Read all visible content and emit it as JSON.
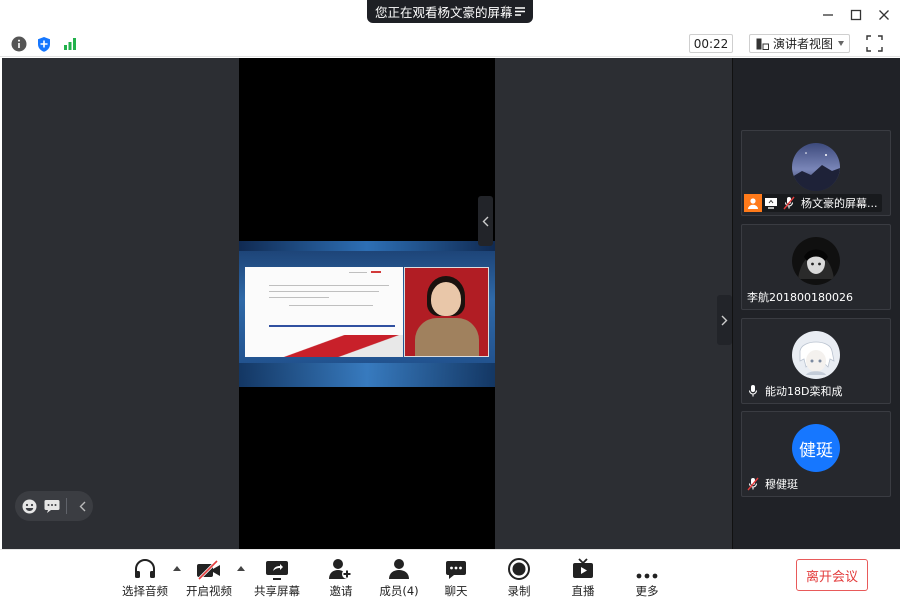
{
  "titlebar": {
    "title": "您正在观看杨文豪的屏幕",
    "menu_icon": "list-icon",
    "window_buttons": [
      "minimize-icon",
      "maximize-icon",
      "close-icon"
    ]
  },
  "infobar": {
    "icons": [
      "info-icon",
      "shield-icon",
      "signal-icon"
    ],
    "timer": "00:22",
    "view_mode": "演讲者视图",
    "fullscreen_icon": "fullscreen-icon"
  },
  "participants": [
    {
      "name": "杨文豪的屏幕...",
      "badges": [
        "host-icon",
        "screen-share-icon",
        "mic-muted-icon"
      ],
      "avatar": "night-sky-avatar"
    },
    {
      "name": "李航201800180026",
      "badges": [],
      "avatar": "dark-anime-avatar"
    },
    {
      "name": "能动18D栾和成",
      "badges": [
        "mic-icon"
      ],
      "avatar": "white-anime-avatar"
    },
    {
      "name": "穆健珽",
      "badges": [
        "mic-muted-icon"
      ],
      "avatar_text": "健珽",
      "avatar_color": "#1677ff"
    }
  ],
  "toolbar": {
    "audio": "选择音频",
    "video": "开启视频",
    "share": "共享屏幕",
    "invite": "邀请",
    "members": "成员(4)",
    "chat": "聊天",
    "record": "录制",
    "live": "直播",
    "more": "更多",
    "leave": "离开会议"
  },
  "colors": {
    "accent": "#1677ff",
    "leave_red": "#e33c3c",
    "signal_green": "#22b14c"
  }
}
